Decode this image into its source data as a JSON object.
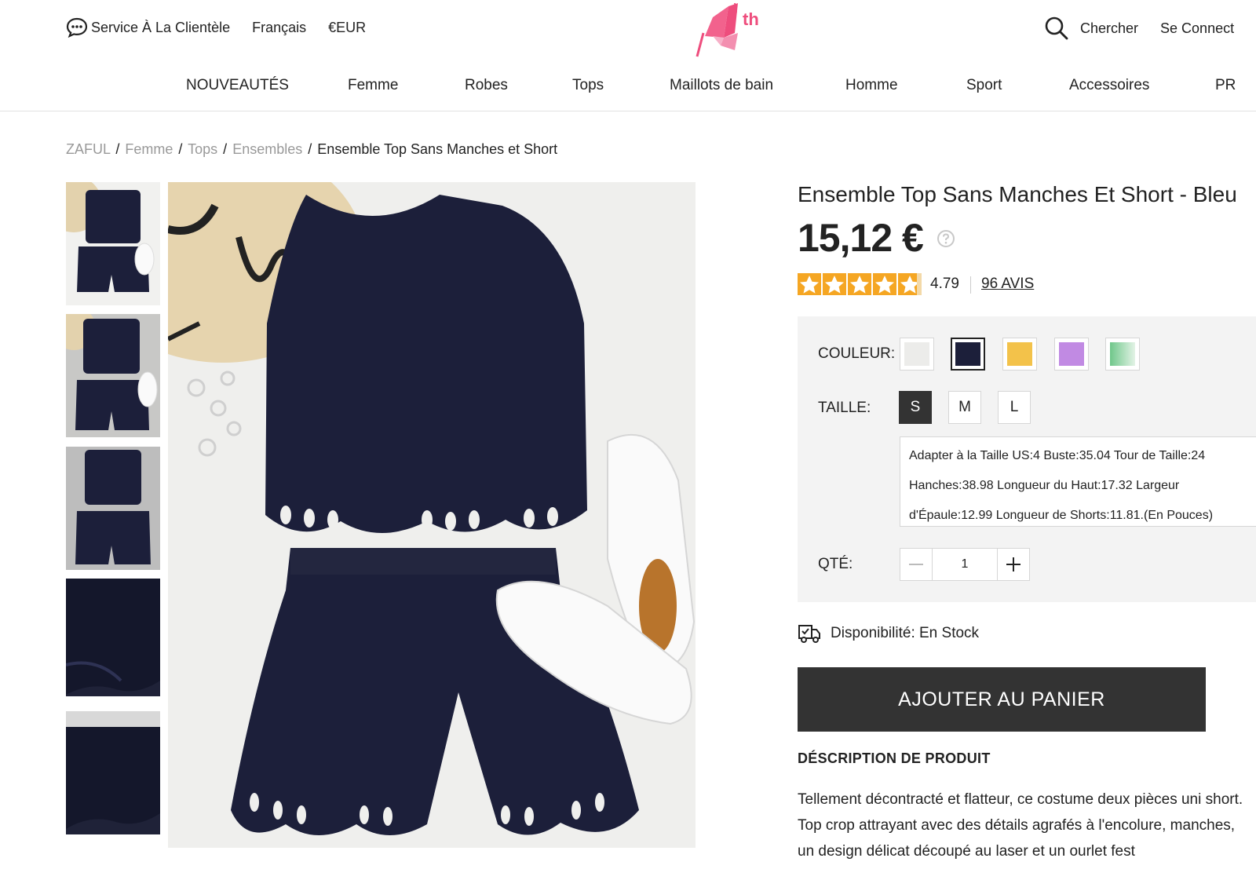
{
  "header": {
    "service_label": "Service À La Clientèle",
    "language_label": "Français",
    "currency_label": "€EUR",
    "logo_text": "th",
    "search_label": "Chercher",
    "login_label": "Se Connect"
  },
  "nav": {
    "items": [
      "NOUVEAUTÉS",
      "Femme",
      "Robes",
      "Tops",
      "Maillots de bain",
      "Homme",
      "Sport",
      "Accessoires",
      "PR"
    ]
  },
  "breadcrumb": {
    "items": [
      "ZAFUL",
      "Femme",
      "Tops",
      "Ensembles"
    ],
    "separator": "/",
    "current": "Ensemble Top Sans Manches et Short"
  },
  "product": {
    "title": "Ensemble Top Sans Manches Et Short - Bleu",
    "price": "15,12 €",
    "rating": "4.79",
    "rating_stars": 4.79,
    "reviews_label": "96 AVIS",
    "color_label": "COULEUR:",
    "colors": [
      "#ececea",
      "#1c1f3a",
      "#f3c24a",
      "#c18ae3",
      "#8ed3a0"
    ],
    "selected_color": "#1c1f3a",
    "size_label": "TAILLE:",
    "sizes": [
      "S",
      "M",
      "L"
    ],
    "selected_size": "S",
    "size_guide": {
      "line1": "Adapter à la Taille US:4   Buste:35.04   Tour de Taille:24",
      "line2": "Hanches:38.98   Longueur du Haut:17.32   Largeur",
      "line3": "d'Épaule:12.99   Longueur de Shorts:11.81.(En Pouces)"
    },
    "qty_label": "QTÉ:",
    "qty_value": "1",
    "availability": "Disponibilité: En Stock",
    "add_to_cart": "AJOUTER AU PANIER",
    "description_title": "DÉSCRIPTION DE PRODUIT",
    "description": "Tellement décontracté et flatteur, ce costume deux pièces uni short. Top crop attrayant avec des détails agrafés à l'encolure, manches, un design délicat découpé au laser et un ourlet fest"
  }
}
